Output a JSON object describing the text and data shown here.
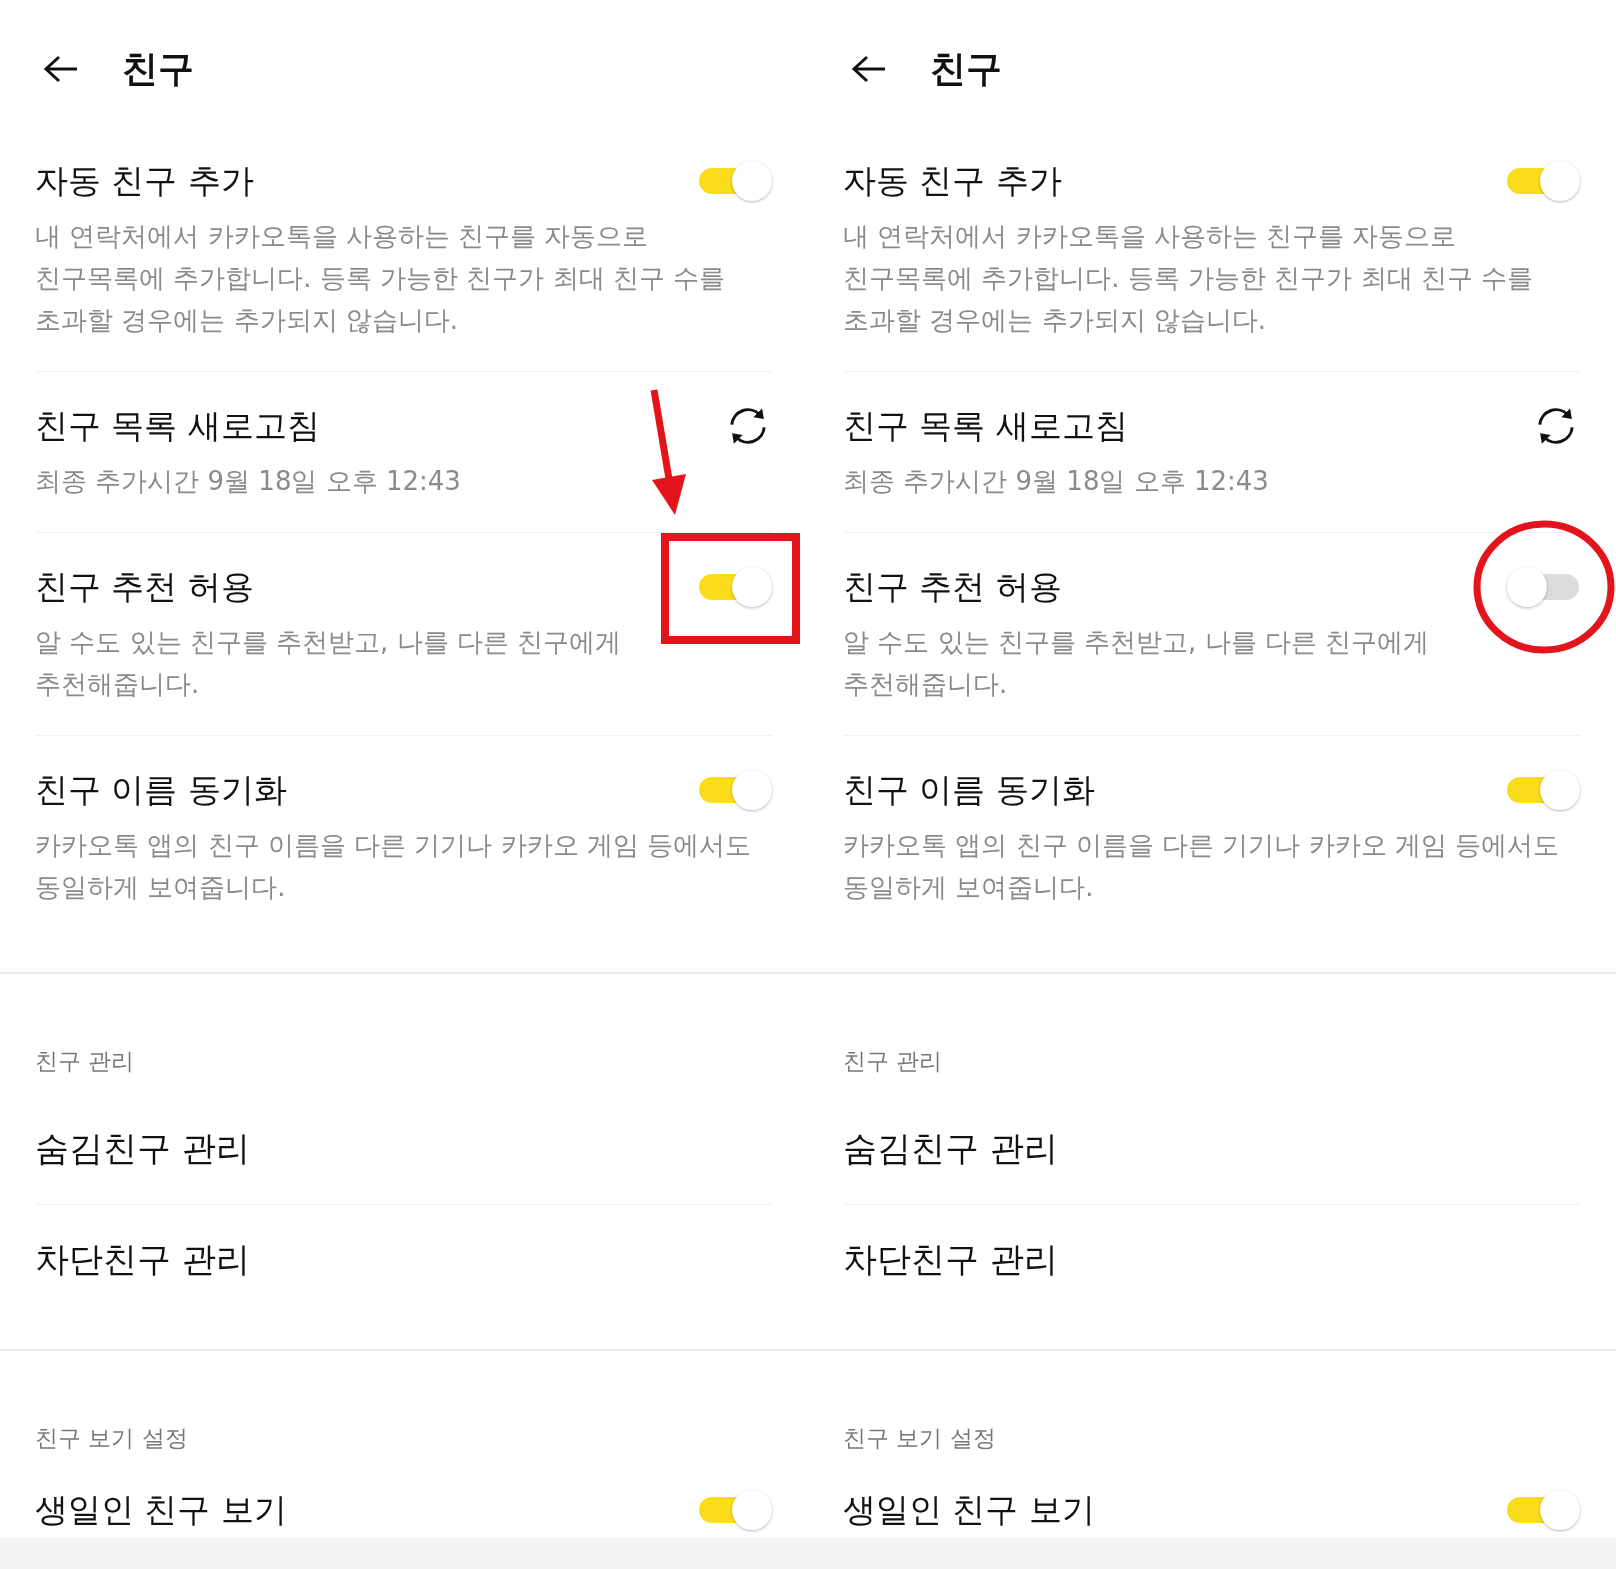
{
  "panels": [
    {
      "header": {
        "title": "친구"
      },
      "sections": [
        {
          "items": [
            {
              "kind": "toggle",
              "title": "자동 친구 추가",
              "description": "내 연락처에서 카카오톡을 사용하는 친구를 자동으로\n친구목록에 추가합니다. 등록 가능한 친구가 최대 친구 수를\n초과할 경우에는 추가되지 않습니다.",
              "on": true
            },
            {
              "kind": "refresh",
              "title": "친구 목록 새로고침",
              "description": "최종 추가시간 9월 18일 오후 12:43"
            },
            {
              "kind": "toggle",
              "title": "친구 추천 허용",
              "description": "알 수도 있는 친구를 추천받고, 나를 다른 친구에게\n추천해줍니다.",
              "on": true,
              "annotations": [
                {
                  "kind": "rectangle"
                },
                {
                  "kind": "arrow"
                }
              ]
            },
            {
              "kind": "toggle",
              "title": "친구 이름 동기화",
              "description": "카카오톡 앱의 친구 이름을 다른 기기나 카카오 게임 등에서도\n동일하게 보여줍니다.",
              "on": true
            }
          ]
        },
        {
          "heading": "친구 관리",
          "items": [
            {
              "kind": "link",
              "title": "숨김친구 관리"
            },
            {
              "kind": "link",
              "title": "차단친구 관리"
            }
          ]
        },
        {
          "heading": "친구 보기 설정",
          "items": [
            {
              "kind": "toggle",
              "title": "생일인 친구 보기",
              "on": true
            }
          ]
        }
      ]
    },
    {
      "header": {
        "title": "친구"
      },
      "sections": [
        {
          "items": [
            {
              "kind": "toggle",
              "title": "자동 친구 추가",
              "description": "내 연락처에서 카카오톡을 사용하는 친구를 자동으로\n친구목록에 추가합니다. 등록 가능한 친구가 최대 친구 수를\n초과할 경우에는 추가되지 않습니다.",
              "on": true
            },
            {
              "kind": "refresh",
              "title": "친구 목록 새로고침",
              "description": "최종 추가시간 9월 18일 오후 12:43"
            },
            {
              "kind": "toggle",
              "title": "친구 추천 허용",
              "description": "알 수도 있는 친구를 추천받고, 나를 다른 친구에게\n추천해줍니다.",
              "on": false,
              "annotations": [
                {
                  "kind": "circle"
                }
              ]
            },
            {
              "kind": "toggle",
              "title": "친구 이름 동기화",
              "description": "카카오톡 앱의 친구 이름을 다른 기기나 카카오 게임 등에서도\n동일하게 보여줍니다.",
              "on": true
            }
          ]
        },
        {
          "heading": "친구 관리",
          "items": [
            {
              "kind": "link",
              "title": "숨김친구 관리"
            },
            {
              "kind": "link",
              "title": "차단친구 관리"
            }
          ]
        },
        {
          "heading": "친구 보기 설정",
          "items": [
            {
              "kind": "toggle",
              "title": "생일인 친구 보기",
              "on": true
            }
          ]
        }
      ]
    }
  ]
}
